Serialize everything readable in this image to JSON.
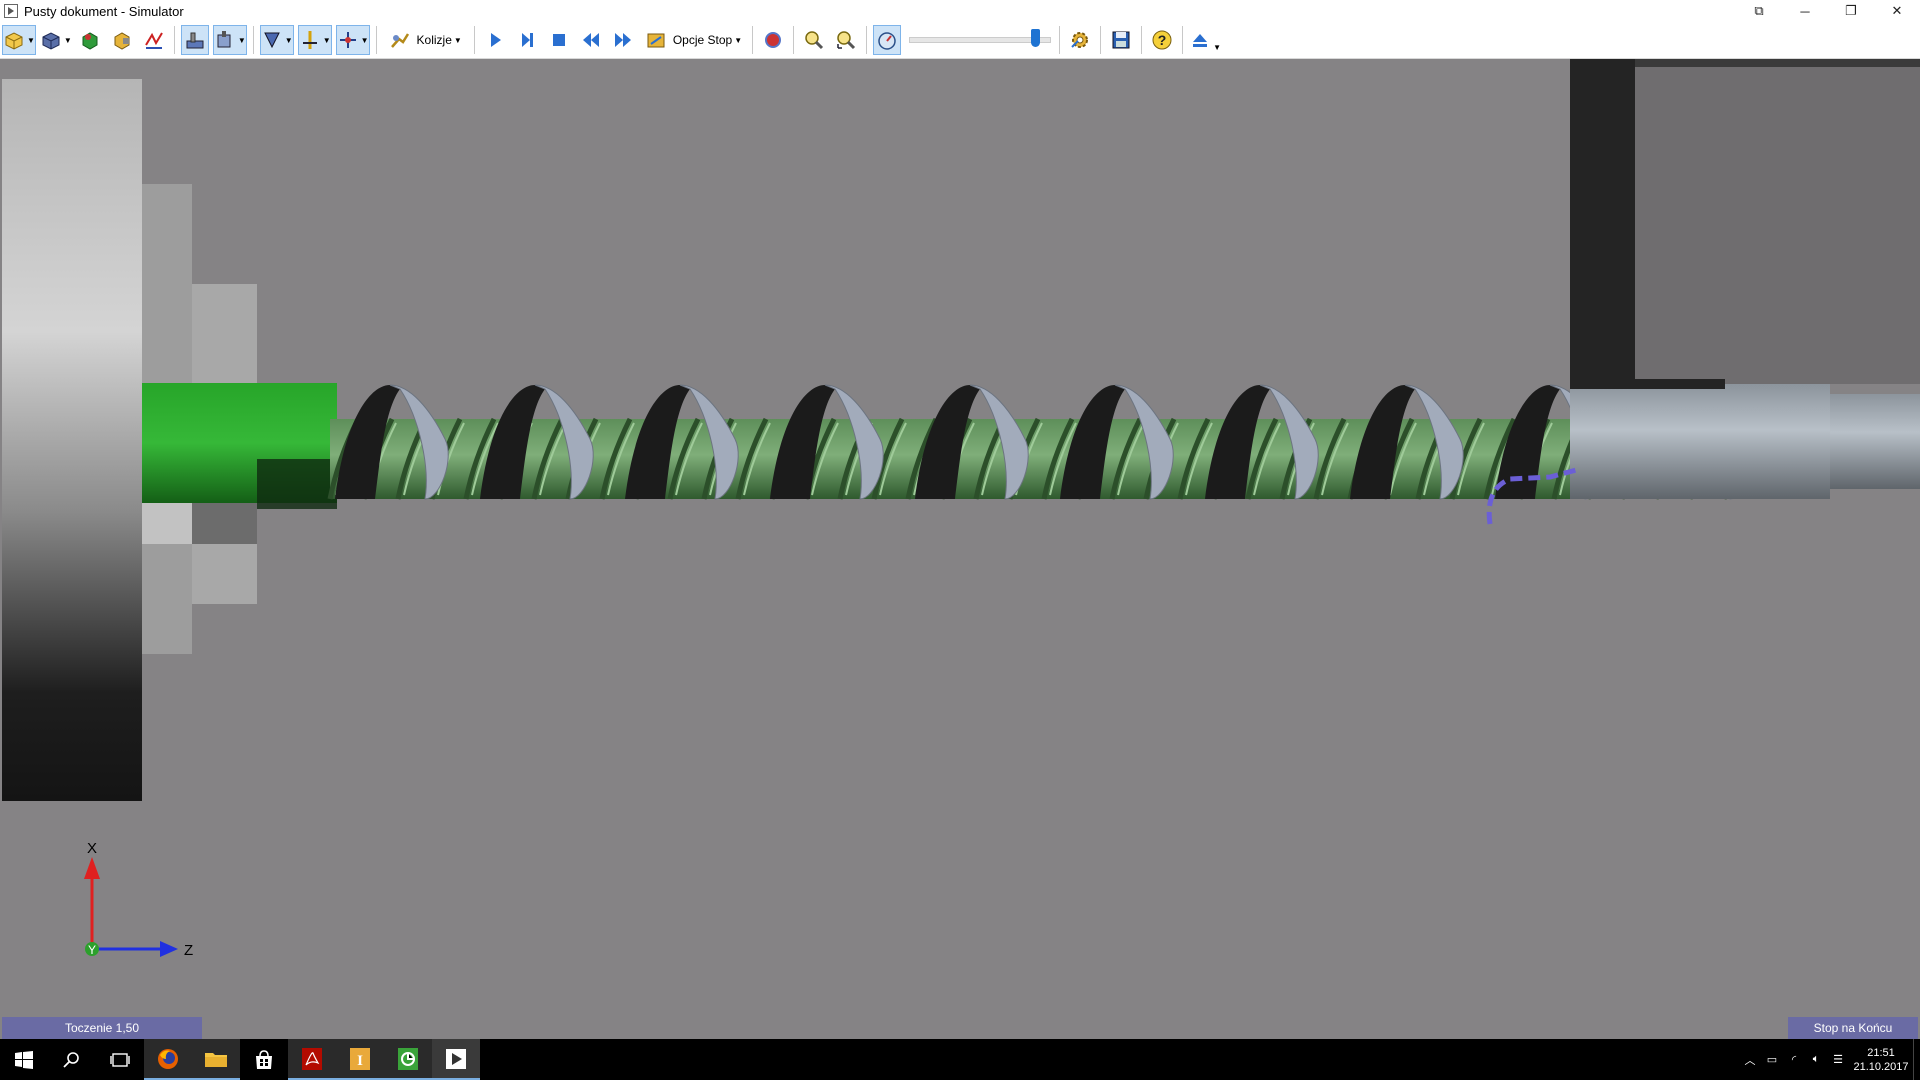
{
  "window": {
    "title": "Pusty dokument - Simulator"
  },
  "toolbar": {
    "collisions_label": "Kolizje",
    "stop_options_label": "Opcje Stop",
    "speed_slider_value": 0.93
  },
  "viewport": {
    "axis_x_label": "X",
    "axis_y_label": "Y",
    "axis_z_label": "Z"
  },
  "status": {
    "operation": "Toczenie 1,50",
    "stop_mode": "Stop na Końcu"
  },
  "taskbar": {
    "time": "21:51",
    "date": "21.10.2017"
  },
  "colors": {
    "viewport_bg": "#858385",
    "workpiece": "#33a533",
    "thread_green": "#4e8a4c",
    "tool_gray": "#9aa3b2",
    "status_bg": "#6a6ba4"
  }
}
